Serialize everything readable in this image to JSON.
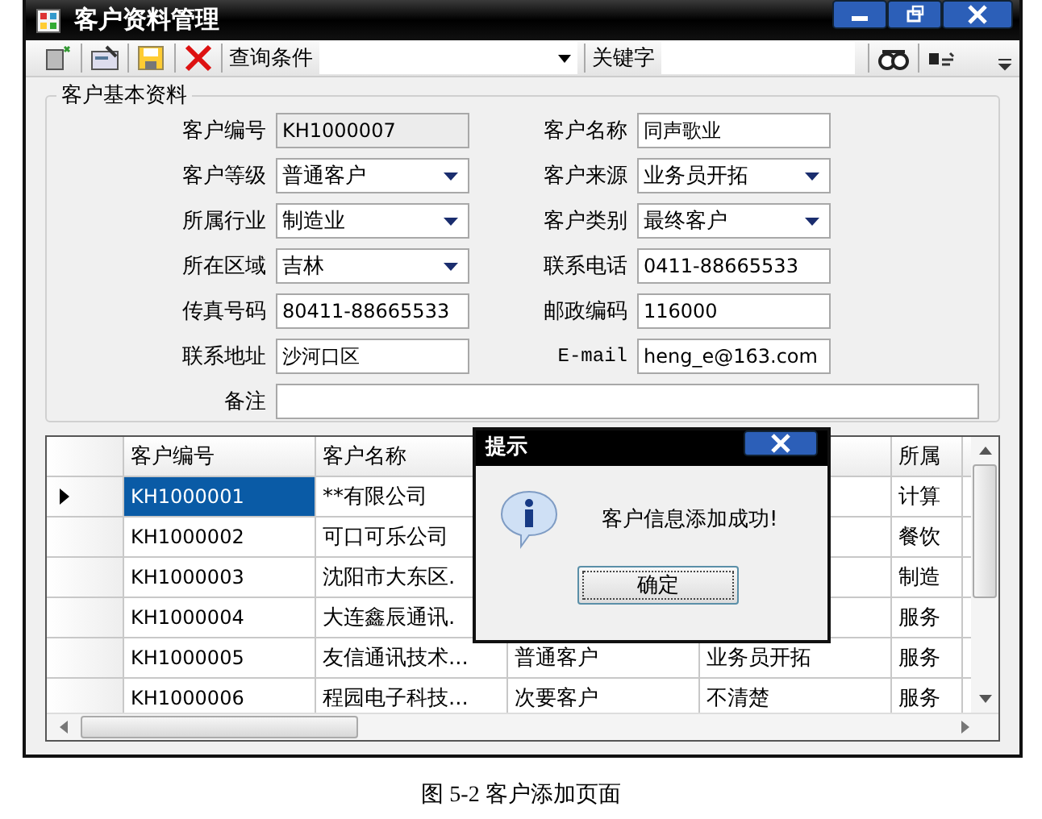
{
  "window": {
    "title": "客户资料管理"
  },
  "toolbar": {
    "query_label": "查询条件",
    "keyword_label": "关键字"
  },
  "group": {
    "title": "客户基本资料",
    "left_fields": [
      {
        "label": "客户编号",
        "value": "KH1000007",
        "kind": "readonly"
      },
      {
        "label": "客户等级",
        "value": "普通客户",
        "kind": "dropdown"
      },
      {
        "label": "所属行业",
        "value": "制造业",
        "kind": "dropdown"
      },
      {
        "label": "所在区域",
        "value": "吉林",
        "kind": "dropdown"
      },
      {
        "label": "传真号码",
        "value": "80411-88665533",
        "kind": "text"
      },
      {
        "label": "联系地址",
        "value": "沙河口区",
        "kind": "text"
      }
    ],
    "right_fields": [
      {
        "label": "客户名称",
        "value": "同声歌业",
        "kind": "text"
      },
      {
        "label": "客户来源",
        "value": "业务员开拓",
        "kind": "dropdown"
      },
      {
        "label": "客户类别",
        "value": "最终客户",
        "kind": "dropdown"
      },
      {
        "label": "联系电话",
        "value": "0411-88665533",
        "kind": "text"
      },
      {
        "label": "邮政编码",
        "value": "116000",
        "kind": "text"
      },
      {
        "label": "E-mail",
        "value": "heng_e@163.com",
        "kind": "text"
      }
    ],
    "memo_label": "备注"
  },
  "table": {
    "columns": [
      "客户编号",
      "客户名称",
      "所属"
    ],
    "rows": [
      {
        "id": "KH1000001",
        "name": "**有限公司",
        "industry": "计算",
        "selected": true
      },
      {
        "id": "KH1000002",
        "name": "可口可乐公司",
        "industry": "餐饮",
        "selected": false
      },
      {
        "id": "KH1000003",
        "name": "沈阳市大东区.",
        "industry": "制造",
        "selected": false
      },
      {
        "id": "KH1000004",
        "name": "大连鑫辰通讯.",
        "industry": "服务",
        "selected": false
      },
      {
        "id": "KH1000005",
        "name": "友信通讯技术...",
        "level": "普通客户",
        "source": "业务员开拓",
        "industry": "服务",
        "selected": false
      },
      {
        "id": "KH1000006",
        "name": "程园电子科技...",
        "level": "次要客户",
        "source": "不清楚",
        "industry": "服务",
        "selected": false
      }
    ]
  },
  "dialog": {
    "title": "提示",
    "message": "客户信息添加成功!",
    "button": "确定"
  },
  "caption": "图 5-2 客户添加页面"
}
